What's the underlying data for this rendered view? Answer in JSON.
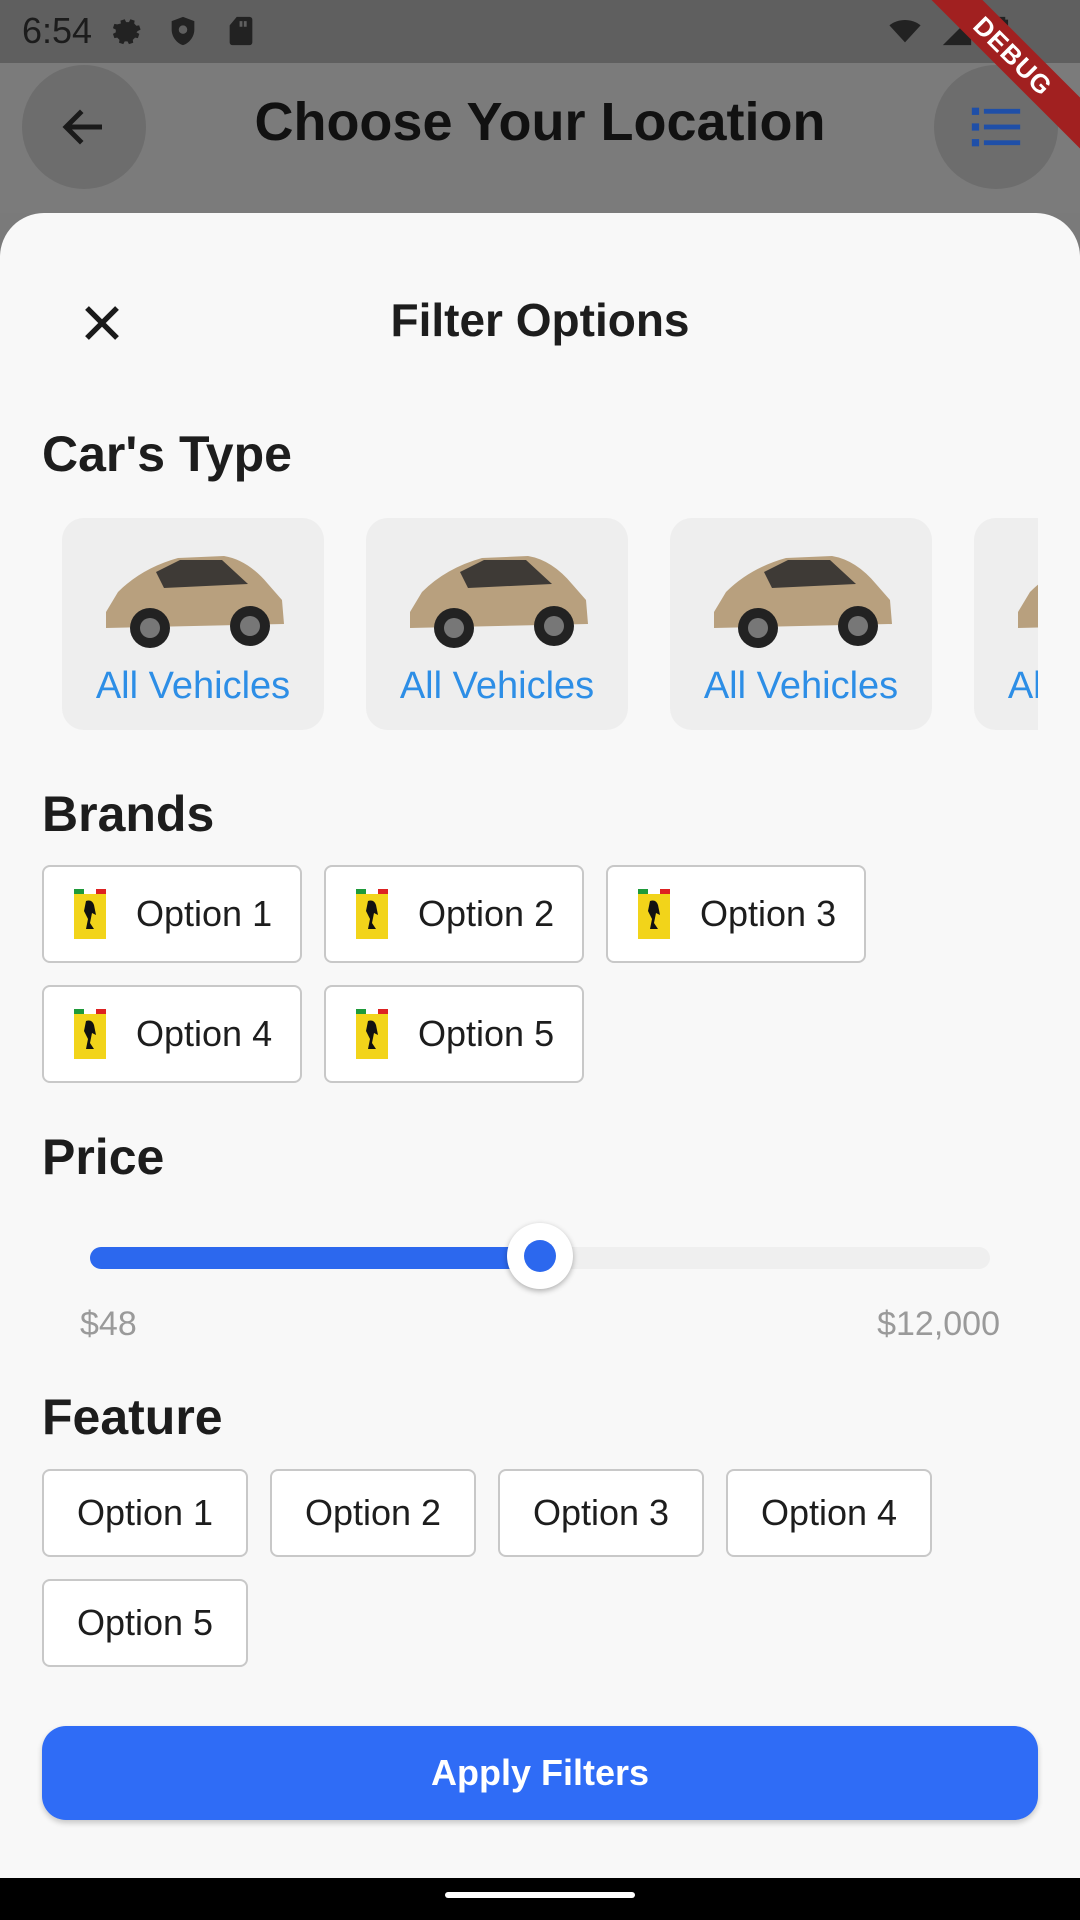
{
  "status_bar": {
    "time": "6:54"
  },
  "app_bar": {
    "title": "Choose Your Location"
  },
  "debug_banner": "DEBUG",
  "sheet": {
    "title": "Filter Options",
    "car_type": {
      "title": "Car's Type",
      "items": [
        {
          "label": "All Vehicles"
        },
        {
          "label": "All Vehicles"
        },
        {
          "label": "All Vehicles"
        },
        {
          "label": "All Vehicles"
        }
      ]
    },
    "brands": {
      "title": "Brands",
      "options": [
        "Option 1",
        "Option 2",
        "Option 3",
        "Option 4",
        "Option 5"
      ]
    },
    "price": {
      "title": "Price",
      "min_label": "$48",
      "max_label": "$12,000",
      "fraction": 0.5
    },
    "feature": {
      "title": "Feature",
      "options": [
        "Option 1",
        "Option 2",
        "Option 3",
        "Option 4",
        "Option 5"
      ]
    },
    "apply_label": "Apply Filters"
  },
  "colors": {
    "accent": "#2f6cf6",
    "car_label": "#2d8ee6",
    "debug": "#a12020"
  },
  "icons": {
    "close": "close-icon",
    "back": "arrow-back-icon",
    "menu": "list-icon",
    "brand_logo": "ferrari-logo-icon",
    "settings": "gear-icon",
    "shield": "shield-icon",
    "sd_card": "sd-card-icon",
    "wifi": "wifi-icon",
    "signal": "signal-icon",
    "battery": "battery-icon"
  }
}
